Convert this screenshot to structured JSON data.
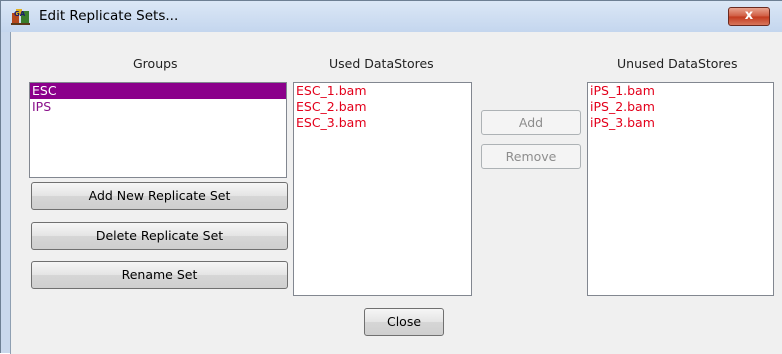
{
  "window": {
    "title": "Edit Replicate Sets...",
    "close_glyph": "x"
  },
  "groups": {
    "header": "Groups",
    "items": [
      {
        "label": "ESC",
        "selected": true
      },
      {
        "label": "IPS",
        "selected": false
      }
    ]
  },
  "used": {
    "header": "Used DataStores",
    "items": [
      "ESC_1.bam",
      "ESC_2.bam",
      "ESC_3.bam"
    ]
  },
  "unused": {
    "header": "Unused DataStores",
    "items": [
      "iPS_1.bam",
      "iPS_2.bam",
      "iPS_3.bam"
    ]
  },
  "buttons": {
    "add_new": "Add New Replicate Set",
    "delete": "Delete Replicate Set",
    "rename": "Rename Set",
    "add": "Add",
    "remove": "Remove",
    "close": "Close"
  },
  "colors": {
    "selection": "#8b008b",
    "group_text": "#8a108a",
    "datastore_text": "#e3001b"
  },
  "icons": {
    "app": "seqmonk-app-icon",
    "close": "close-icon"
  }
}
